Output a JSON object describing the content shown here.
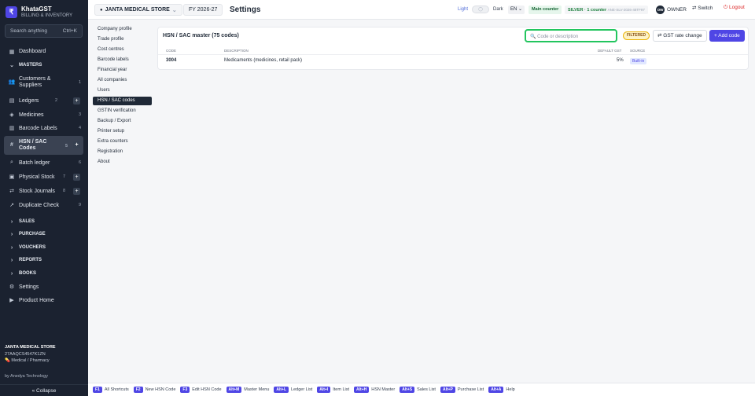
{
  "app": {
    "name": "KhataGST",
    "subtitle": "BILLING & INVENTORY",
    "logo_glyph": "₹"
  },
  "sidebar": {
    "search_placeholder": "Search anything",
    "search_shortcut": "Ctrl+K",
    "items": [
      {
        "label": "Dashboard",
        "icon": "grid-icon"
      },
      {
        "label": "MASTERS",
        "icon": "chevron-down-icon"
      },
      {
        "label": "Customers & Suppliers",
        "count": "1",
        "icon": "users-icon"
      },
      {
        "label": "Ledgers",
        "count": "2",
        "icon": "ledger-icon"
      },
      {
        "label": "Medicines",
        "count": "3",
        "icon": "tag-icon"
      },
      {
        "label": "Barcode Labels",
        "count": "4",
        "icon": "barcode-icon"
      },
      {
        "label": "HSN / SAC Codes",
        "count": "5",
        "icon": "hash-icon"
      },
      {
        "label": "Batch ledger",
        "count": "6",
        "icon": "search-icon"
      },
      {
        "label": "Physical Stock",
        "count": "7",
        "icon": "box-icon"
      },
      {
        "label": "Stock Journals",
        "count": "8",
        "icon": "shuffle-icon"
      },
      {
        "label": "Duplicate Check",
        "count": "9",
        "icon": "wand-icon"
      }
    ],
    "sections": [
      "SALES",
      "PURCHASE",
      "VOUCHERS",
      "REPORTS",
      "BOOKS"
    ],
    "bottom_items": [
      {
        "label": "Settings",
        "icon": "gear-icon"
      },
      {
        "label": "Product Home",
        "icon": "play-icon"
      }
    ],
    "footer": {
      "store": "JANTA MEDICAL STORE",
      "gstin": "27AAQCS4547K1ZN",
      "type": "Medical / Pharmacy",
      "by": "by Anedya Technology",
      "collapse": "« Collapse"
    }
  },
  "topbar": {
    "store": "JANTA MEDICAL STORE",
    "fy": "FY 2026-27",
    "title": "Settings",
    "light": "Light",
    "dark": "Dark",
    "lang": "EN",
    "main_counter": "Main counter",
    "silver": "SILVER · 1 counter",
    "silver_code": "ANE-SLV-2026-48TF97",
    "owner_initials": "OW",
    "owner": "OWNER",
    "switch": "Switch",
    "logout": "Logout"
  },
  "settings_menu": [
    "Company profile",
    "Trade profile",
    "Cost centres",
    "Barcode labels",
    "Financial year",
    "All companies",
    "Users",
    "HSN / SAC codes",
    "GSTIN verification",
    "Backup / Export",
    "Printer setup",
    "Extra counters",
    "Registration",
    "About"
  ],
  "settings_menu_active": "HSN / SAC codes",
  "card": {
    "title": "HSN / SAC master (75 codes)",
    "search_placeholder": "Code or description",
    "filtered": "FILTERED",
    "gst_btn": "GST rate change",
    "add_btn": "+ Add code",
    "columns": [
      "CODE",
      "DESCRIPTION",
      "DEFAULT GST",
      "SOURCE"
    ],
    "rows": [
      {
        "code": "3004",
        "description": "Medicaments (medicines, retail pack)",
        "gst": "5%",
        "source": "Built-in"
      }
    ]
  },
  "shortcuts": [
    {
      "key": "F1",
      "label": "All Shortcuts"
    },
    {
      "key": "F2",
      "label": "New HSN Code"
    },
    {
      "key": "F3",
      "label": "Edit HSN Code"
    },
    {
      "key": "Alt+M",
      "label": "Master Menu"
    },
    {
      "key": "Alt+L",
      "label": "Ledger List"
    },
    {
      "key": "Alt+I",
      "label": "Item List"
    },
    {
      "key": "Alt+H",
      "label": "HSN Master"
    },
    {
      "key": "Alt+S",
      "label": "Sales List"
    },
    {
      "key": "Alt+P",
      "label": "Purchase List"
    },
    {
      "key": "Alt+A",
      "label": "Help"
    }
  ],
  "colors": {
    "accent": "#4f46e5",
    "sidebar": "#1b2230",
    "search_focus": "#22c55e"
  }
}
